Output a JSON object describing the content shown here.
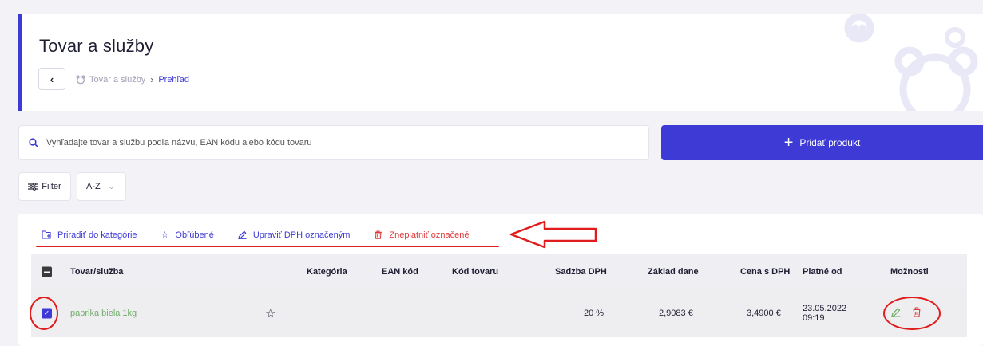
{
  "header": {
    "title": "Tovar a služby",
    "breadcrumb": {
      "home": "Tovar a služby",
      "current": "Prehľad"
    }
  },
  "search": {
    "placeholder": "Vyhľadajte tovar a službu podľa názvu, EAN kódu alebo kódu tovaru"
  },
  "add_button": {
    "label": "Pridať produkt"
  },
  "filter": {
    "label": "Filter"
  },
  "sort": {
    "selected": "A-Z"
  },
  "bulk_actions": [
    {
      "label": "Priradiť do kategórie",
      "icon": "folder-add-icon"
    },
    {
      "label": "Obľúbené",
      "icon": "star-icon"
    },
    {
      "label": "Upraviť DPH označeným",
      "icon": "pencil-icon"
    },
    {
      "label": "Zneplatniť označené",
      "icon": "trash-icon"
    }
  ],
  "table": {
    "columns": [
      "Tovar/služba",
      "Kategória",
      "EAN kód",
      "Kód tovaru",
      "Sadzba DPH",
      "Základ dane",
      "Cena s DPH",
      "Platné od",
      "Možnosti"
    ],
    "rows": [
      {
        "name": "paprika biela 1kg",
        "category": "",
        "ean": "",
        "code": "",
        "vat_rate": "20 %",
        "base": "2,9083 €",
        "price_vat": "3,4900 €",
        "valid_from_date": "23.05.2022",
        "valid_from_time": "09:19",
        "checked": true
      }
    ]
  },
  "colors": {
    "accent": "#3d3ad6",
    "danger": "#e03a3a",
    "success": "#6fae6a",
    "annotation": "#e01c1c"
  }
}
